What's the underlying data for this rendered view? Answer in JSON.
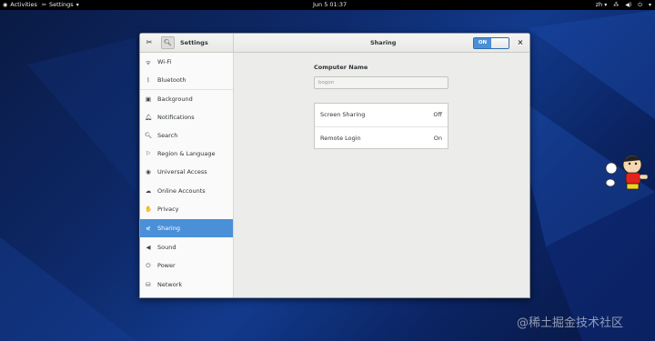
{
  "topbar": {
    "activities": "Activities",
    "app_menu": "Settings",
    "clock": "Jun 5  01:37",
    "lang": "zh"
  },
  "window": {
    "app_title": "Settings",
    "panel_title": "Sharing",
    "toggle_label": "ON",
    "close_glyph": "×"
  },
  "sidebar": {
    "items": [
      {
        "label": "Wi-Fi",
        "icon": "wifi-icon"
      },
      {
        "label": "Bluetooth",
        "icon": "bluetooth-icon"
      },
      {
        "label": "Background",
        "icon": "background-icon"
      },
      {
        "label": "Notifications",
        "icon": "notifications-icon"
      },
      {
        "label": "Search",
        "icon": "search-icon"
      },
      {
        "label": "Region & Language",
        "icon": "region-icon"
      },
      {
        "label": "Universal Access",
        "icon": "universal-access-icon"
      },
      {
        "label": "Online Accounts",
        "icon": "online-accounts-icon"
      },
      {
        "label": "Privacy",
        "icon": "privacy-icon"
      },
      {
        "label": "Sharing",
        "icon": "sharing-icon"
      },
      {
        "label": "Sound",
        "icon": "sound-icon"
      },
      {
        "label": "Power",
        "icon": "power-icon"
      },
      {
        "label": "Network",
        "icon": "network-icon"
      }
    ],
    "active": "Sharing"
  },
  "sharing": {
    "computer_name_label": "Computer Name",
    "computer_name_value": "bogon",
    "rows": [
      {
        "label": "Screen Sharing",
        "value": "Off"
      },
      {
        "label": "Remote Login",
        "value": "On"
      }
    ]
  },
  "watermark": "@稀土掘金技术社区",
  "colors": {
    "accent": "#4a90d9",
    "topbar": "#000000",
    "desktop": "#0e2a6b"
  }
}
